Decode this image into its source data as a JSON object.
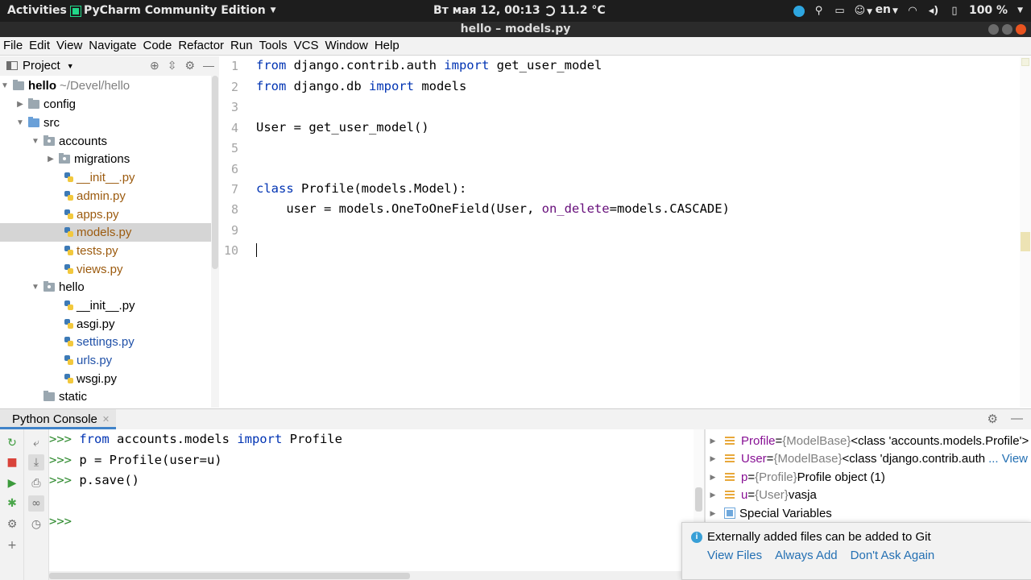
{
  "topbar": {
    "activities": "Activities",
    "app_name": "PyCharm Community Edition",
    "clock": "Вт мая 12, 00:13",
    "weather": "11.2 °C",
    "language": "en",
    "battery": "100 %"
  },
  "window": {
    "title": "hello – models.py"
  },
  "menu": [
    "File",
    "Edit",
    "View",
    "Navigate",
    "Code",
    "Refactor",
    "Run",
    "Tools",
    "VCS",
    "Window",
    "Help"
  ],
  "project": {
    "header": "Project",
    "root_name": "hello",
    "root_path": "~/Devel/hello",
    "items": [
      {
        "label": "config"
      },
      {
        "label": "src"
      },
      {
        "label": "accounts"
      },
      {
        "label": "migrations"
      },
      {
        "label": "__init__.py"
      },
      {
        "label": "admin.py"
      },
      {
        "label": "apps.py"
      },
      {
        "label": "models.py"
      },
      {
        "label": "tests.py"
      },
      {
        "label": "views.py"
      },
      {
        "label": "hello"
      },
      {
        "label": "__init__.py"
      },
      {
        "label": "asgi.py"
      },
      {
        "label": "settings.py"
      },
      {
        "label": "urls.py"
      },
      {
        "label": "wsgi.py"
      },
      {
        "label": "static"
      }
    ]
  },
  "editor": {
    "line_numbers": [
      "1",
      "2",
      "3",
      "4",
      "5",
      "6",
      "7",
      "8",
      "9",
      "10"
    ],
    "lines": {
      "l1": {
        "kw1": "from",
        "mod": " django.contrib.auth ",
        "kw2": "import",
        "rest": " get_user_model"
      },
      "l2": {
        "kw1": "from",
        "mod": " django.db ",
        "kw2": "import",
        "rest": " models"
      },
      "l4": {
        "text": "User = get_user_model()"
      },
      "l7": {
        "kw": "class",
        "rest": " Profile(models.Model):"
      },
      "l8": {
        "pre": "    user = models.OneToOneField(User, ",
        "param": "on_delete",
        "post": "=models.CASCADE)"
      }
    }
  },
  "console": {
    "tab": "Python Console",
    "prompt": ">>>",
    "lines": {
      "c1": {
        "kw1": "from",
        "mod": " accounts.models ",
        "kw2": "import",
        "rest": " Profile"
      },
      "c2": {
        "text": " p = Profile(user=u)"
      },
      "c3": {
        "text": " p.save()"
      }
    }
  },
  "variables": [
    {
      "name": "Profile",
      "eq": " = ",
      "type": "{ModelBase}",
      "value": " <class 'accounts.models.Profile'>"
    },
    {
      "name": "User",
      "eq": " = ",
      "type": "{ModelBase}",
      "value": " <class 'django.contrib.auth",
      "more": "... View"
    },
    {
      "name": "p",
      "eq": " = ",
      "type": "{Profile}",
      "value": " Profile object (1)"
    },
    {
      "name": "u",
      "eq": " = ",
      "type": "{User}",
      "value": " vasja"
    },
    {
      "name": "Special Variables"
    }
  ],
  "notification": {
    "message": "Externally added files can be added to Git",
    "actions": [
      "View Files",
      "Always Add",
      "Don't Ask Again"
    ]
  },
  "colors": {
    "keyword": "#0033b3",
    "param": "#660e7a",
    "prompt": "#2e8a2e",
    "link": "#2470b3",
    "var_name": "#871094"
  }
}
